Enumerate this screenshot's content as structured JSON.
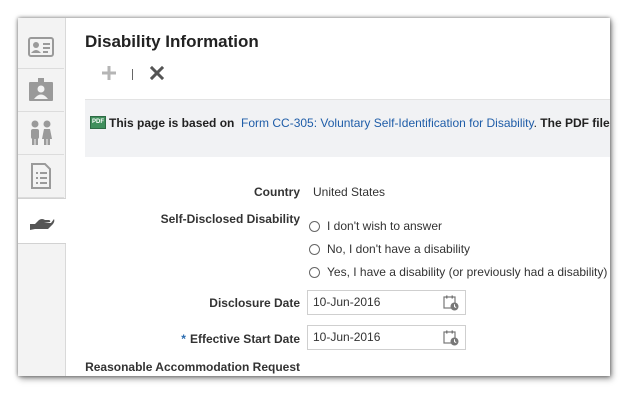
{
  "page": {
    "title": "Disability Information"
  },
  "toolbar": {
    "add_icon": "plus-icon",
    "delete_icon": "x-icon"
  },
  "tabs": [
    {
      "icon": "id-card-icon",
      "active": false
    },
    {
      "icon": "badge-person-icon",
      "active": false
    },
    {
      "icon": "people-icon",
      "active": false
    },
    {
      "icon": "document-list-icon",
      "active": false
    },
    {
      "icon": "hand-icon",
      "active": true
    }
  ],
  "info": {
    "pdf_icon_text": "PDF",
    "prefix": "This page is based on",
    "link": "Form CC-305: Voluntary Self-Identification for Disability",
    "punct": ".",
    "suffix": "The PDF file di"
  },
  "form": {
    "country_label": "Country",
    "country_value": "United States",
    "disability_label": "Self-Disclosed Disability",
    "options": [
      "I don't wish to answer",
      "No, I don't have a disability",
      "Yes, I have a disability (or previously had a disability)"
    ],
    "disclosure_date_label": "Disclosure Date",
    "disclosure_date_value": "10-Jun-2016",
    "required_marker": "*",
    "effective_start_date_label": "Effective Start Date",
    "effective_start_date_value": "10-Jun-2016",
    "accommodation_label": "Reasonable Accommodation Request"
  },
  "colors": {
    "link": "#1f5da8",
    "required": "#2b6cb0",
    "info_bg": "#f1f2f4",
    "tab_strip_bg": "#f3f3f3"
  }
}
